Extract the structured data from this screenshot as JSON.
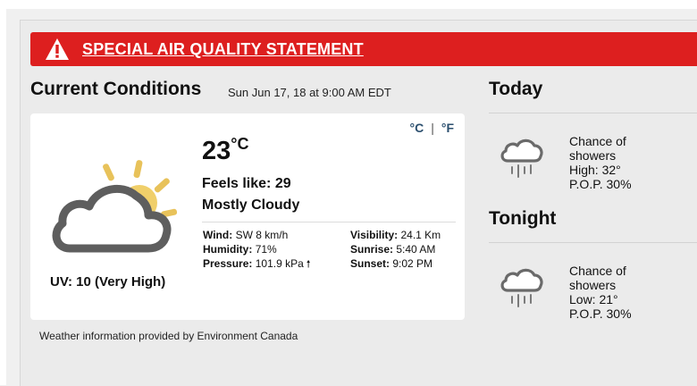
{
  "alert": {
    "icon": "warning-triangle-icon",
    "text": "SPECIAL AIR QUALITY STATEMENT",
    "color": "#dd1f1f"
  },
  "current": {
    "title": "Current Conditions",
    "timestamp": "Sun Jun 17, 18 at 9:00 AM EDT",
    "units": {
      "celsius": "°C",
      "separator": "|",
      "fahrenheit": "°F"
    },
    "icon": "sun-behind-cloud-icon",
    "uv": "UV: 10 (Very High)",
    "temperature": "23",
    "temperature_unit": "°C",
    "feels_like": "Feels like: 29",
    "condition": "Mostly Cloudy",
    "wind_label": "Wind:",
    "wind_value": "SW 8 km/h",
    "humidity_label": "Humidity:",
    "humidity_value": "71%",
    "pressure_label": "Pressure:",
    "pressure_value": "101.9 kPa",
    "pressure_trend_icon": "rising-arrow-icon",
    "visibility_label": "Visibility:",
    "visibility_value": "24.1 Km",
    "sunrise_label": "Sunrise:",
    "sunrise_value": "5:40 AM",
    "sunset_label": "Sunset:",
    "sunset_value": "9:02 PM"
  },
  "source_note": "Weather information provided by Environment Canada",
  "today": {
    "title": "Today",
    "icon": "rain-cloud-icon",
    "line1": "Chance of",
    "line2": "showers",
    "line3": "High: 32°",
    "line4": "P.O.P. 30%"
  },
  "tonight": {
    "title": "Tonight",
    "icon": "rain-cloud-icon",
    "line1": "Chance of",
    "line2": "showers",
    "line3": "Low: 21°",
    "line4": "P.O.P. 30%"
  }
}
